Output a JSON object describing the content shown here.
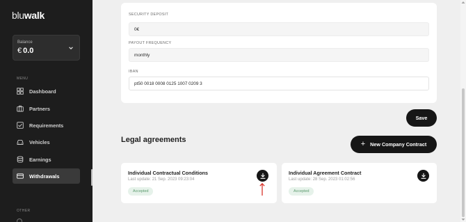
{
  "app": {
    "logo_light": "blu",
    "logo_bold": "walk"
  },
  "balance": {
    "label": "Balance",
    "currency": "€",
    "amount": "0.0"
  },
  "menu": {
    "section_label": "MENU",
    "items": [
      {
        "label": "Dashboard",
        "icon": "grid-icon"
      },
      {
        "label": "Partners",
        "icon": "briefcase-icon"
      },
      {
        "label": "Requirements",
        "icon": "checkbox-icon"
      },
      {
        "label": "Vehicles",
        "icon": "car-icon"
      },
      {
        "label": "Earnings",
        "icon": "coins-icon"
      },
      {
        "label": "Withdrawals",
        "icon": "credit-card-icon"
      }
    ],
    "active": "Withdrawals",
    "other_label": "OTHER"
  },
  "form": {
    "security_deposit": {
      "label": "SECURITY DEPOSIT",
      "value": "0€"
    },
    "payout_frequency": {
      "label": "PAYOUT FREQUENCY",
      "value": "monthly"
    },
    "iban": {
      "label": "IBAN",
      "value": "pt50 0018 0008 0125 1007 0209 3"
    }
  },
  "actions": {
    "save_label": "Save",
    "new_contract_label": "New Company Contract",
    "new_contract_icon": "+"
  },
  "legal": {
    "title": "Legal agreements",
    "agreements": [
      {
        "title": "Individual Contractual Conditions",
        "last_update": "Last update: 21 Sep. 2023 09:23:04",
        "status": "Accepted"
      },
      {
        "title": "Individual Agreement Contract",
        "last_update": "Last update: 28 Sep. 2023 01:02:56",
        "status": "Accepted"
      }
    ]
  },
  "colors": {
    "sidebar_bg": "#1d1d1d",
    "button_dark": "#161616",
    "badge_text": "#5b9a6d",
    "badge_bg": "#e6f2ea",
    "annotation_arrow": "#d9342b"
  }
}
